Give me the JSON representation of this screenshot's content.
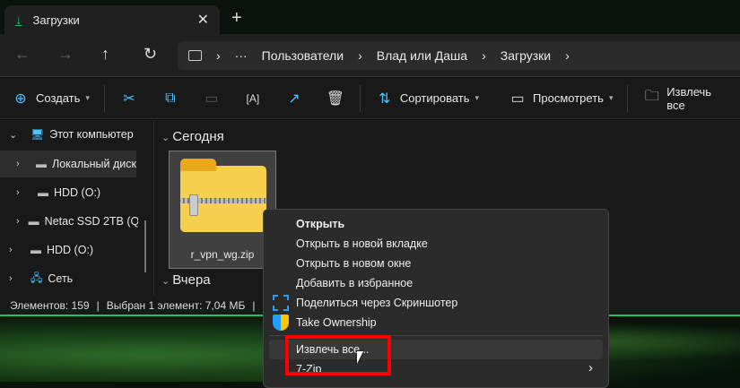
{
  "tab": {
    "title": "Загрузки",
    "close": "✕",
    "new_tab": "+"
  },
  "nav": {
    "back": "←",
    "forward": "→",
    "up": "↑",
    "refresh": "↻",
    "more": "···",
    "breadcrumb": [
      "Пользователи",
      "Влад или Даша",
      "Загрузки"
    ],
    "sep": "›"
  },
  "toolbar": {
    "create": "Создать",
    "sort": "Сортировать",
    "view": "Просмотреть",
    "extract_all": "Извлечь все"
  },
  "sidebar": {
    "items": [
      {
        "label": "Этот компьютер"
      },
      {
        "label": "Локальный диск"
      },
      {
        "label": "HDD (O:)"
      },
      {
        "label": "Netac SSD 2TB (Q"
      },
      {
        "label": "HDD (O:)"
      },
      {
        "label": "Сеть"
      }
    ]
  },
  "content": {
    "group_today": "Сегодня",
    "group_yesterday": "Вчера",
    "file_name": "r_vpn_wg.zip"
  },
  "status": {
    "count": "Элементов: 159",
    "selected": "Выбран 1 элемент: 7,04 МБ",
    "sep": "|"
  },
  "context_menu": {
    "items": [
      "Открыть",
      "Открыть в новой вкладке",
      "Открыть в новом окне",
      "Добавить в избранное",
      "Поделиться через Скриншотер",
      "Take Ownership",
      "Извлечь все...",
      "7-Zip"
    ],
    "submenu_arrow": "›"
  },
  "colors": {
    "accent": "#1fc36a",
    "highlight": "#ff0000",
    "icon_blue": "#4cc2ff"
  }
}
